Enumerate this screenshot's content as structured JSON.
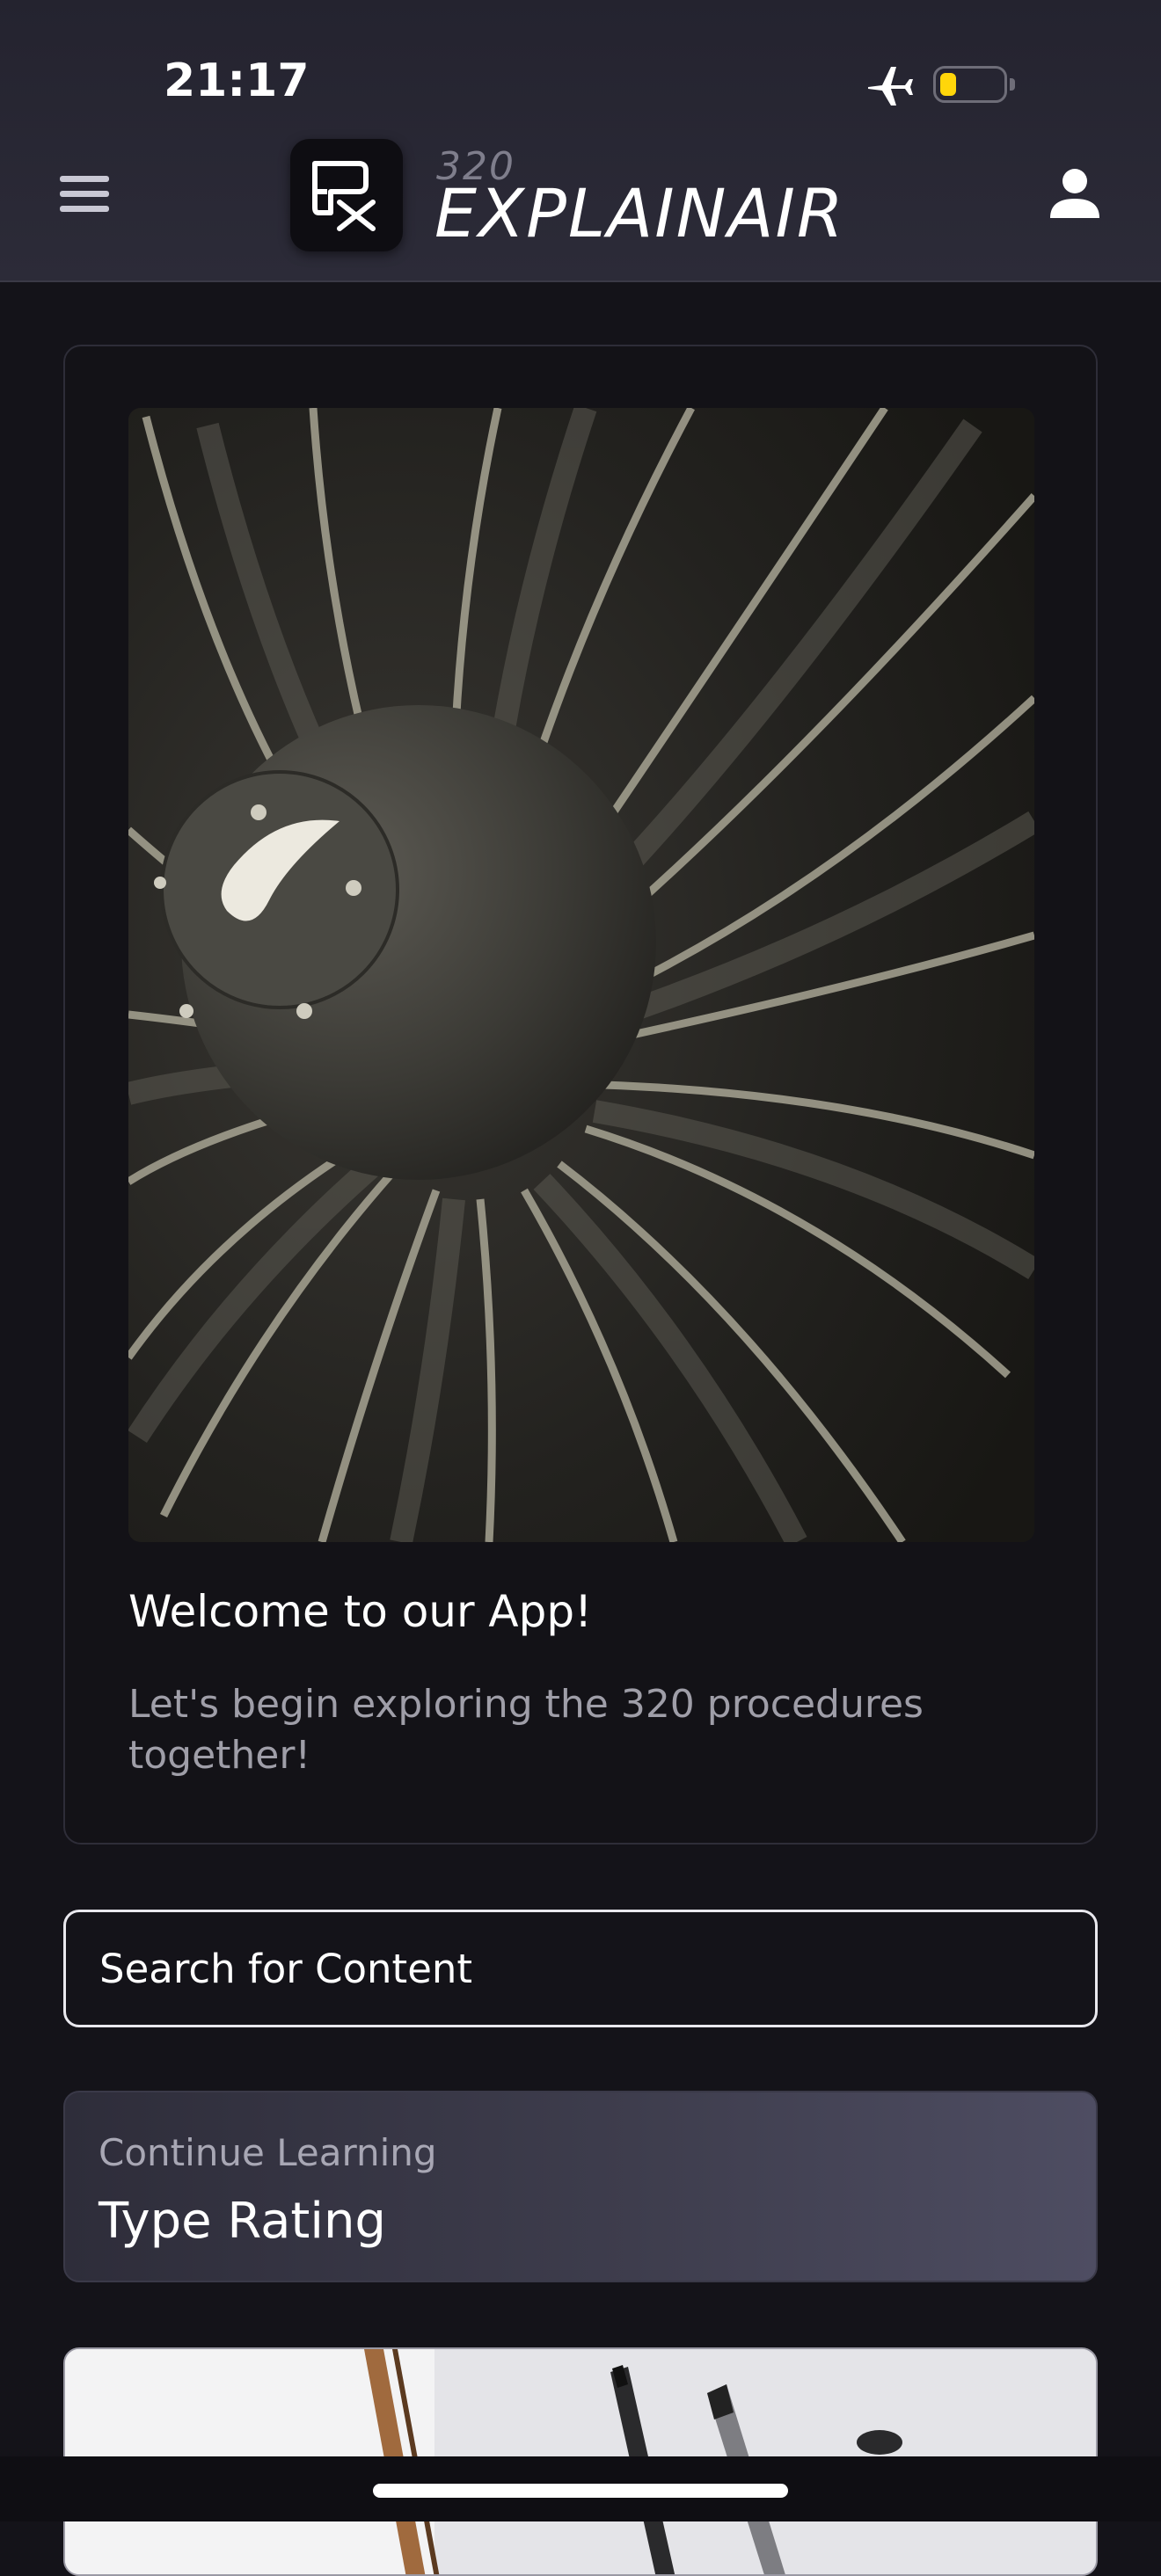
{
  "status_bar": {
    "time": "21:17"
  },
  "header": {
    "brand_small": "320",
    "brand_name": "EXPLAINAIR",
    "icons": [
      "menu-icon",
      "logo-icon",
      "user-icon"
    ]
  },
  "welcome": {
    "image": "jet-engine-fan-photo",
    "title": "Welcome to our App!",
    "subtitle": "Let's begin exploring the 320 procedures together!"
  },
  "search": {
    "placeholder": "Search for Content"
  },
  "continue_learning": {
    "label": "Continue Learning",
    "title": "Type Rating"
  },
  "next_card": {
    "image": "desk-with-pencils-photo"
  },
  "colors": {
    "background": "#141319",
    "header": "#2c2b38",
    "battery": "#ffd60a",
    "text_muted": "#9f9ea8"
  }
}
